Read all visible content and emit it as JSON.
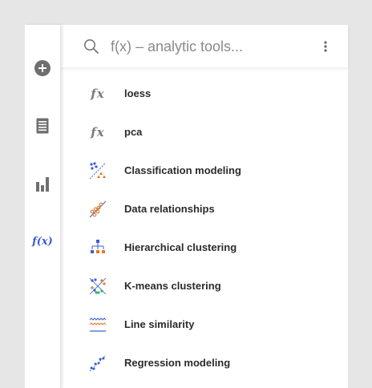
{
  "search": {
    "placeholder": "f(x) – analytic tools..."
  },
  "rail": {
    "items": [
      {
        "icon": "add-circle-icon",
        "active": false
      },
      {
        "icon": "data-table-icon",
        "active": false
      },
      {
        "icon": "bar-chart-icon",
        "active": false
      },
      {
        "icon": "fx-icon",
        "active": true,
        "glyph": "f(x)"
      }
    ]
  },
  "tools": {
    "items": [
      {
        "label": "loess",
        "icon": "fx-icon",
        "glyph": "fx"
      },
      {
        "label": "pca",
        "icon": "fx-icon",
        "glyph": "fx"
      },
      {
        "label": "Classification modeling",
        "icon": "classification-modeling-icon"
      },
      {
        "label": "Data relationships",
        "icon": "data-relationships-icon"
      },
      {
        "label": "Hierarchical clustering",
        "icon": "hierarchical-clustering-icon"
      },
      {
        "label": "K-means clustering",
        "icon": "k-means-clustering-icon"
      },
      {
        "label": "Line similarity",
        "icon": "line-similarity-icon"
      },
      {
        "label": "Regression modeling",
        "icon": "regression-modeling-icon"
      }
    ]
  },
  "colors": {
    "accent": "#3e5bd6",
    "icon_gray": "#6f6f6f",
    "rail_fx": "#3e5bd6"
  }
}
